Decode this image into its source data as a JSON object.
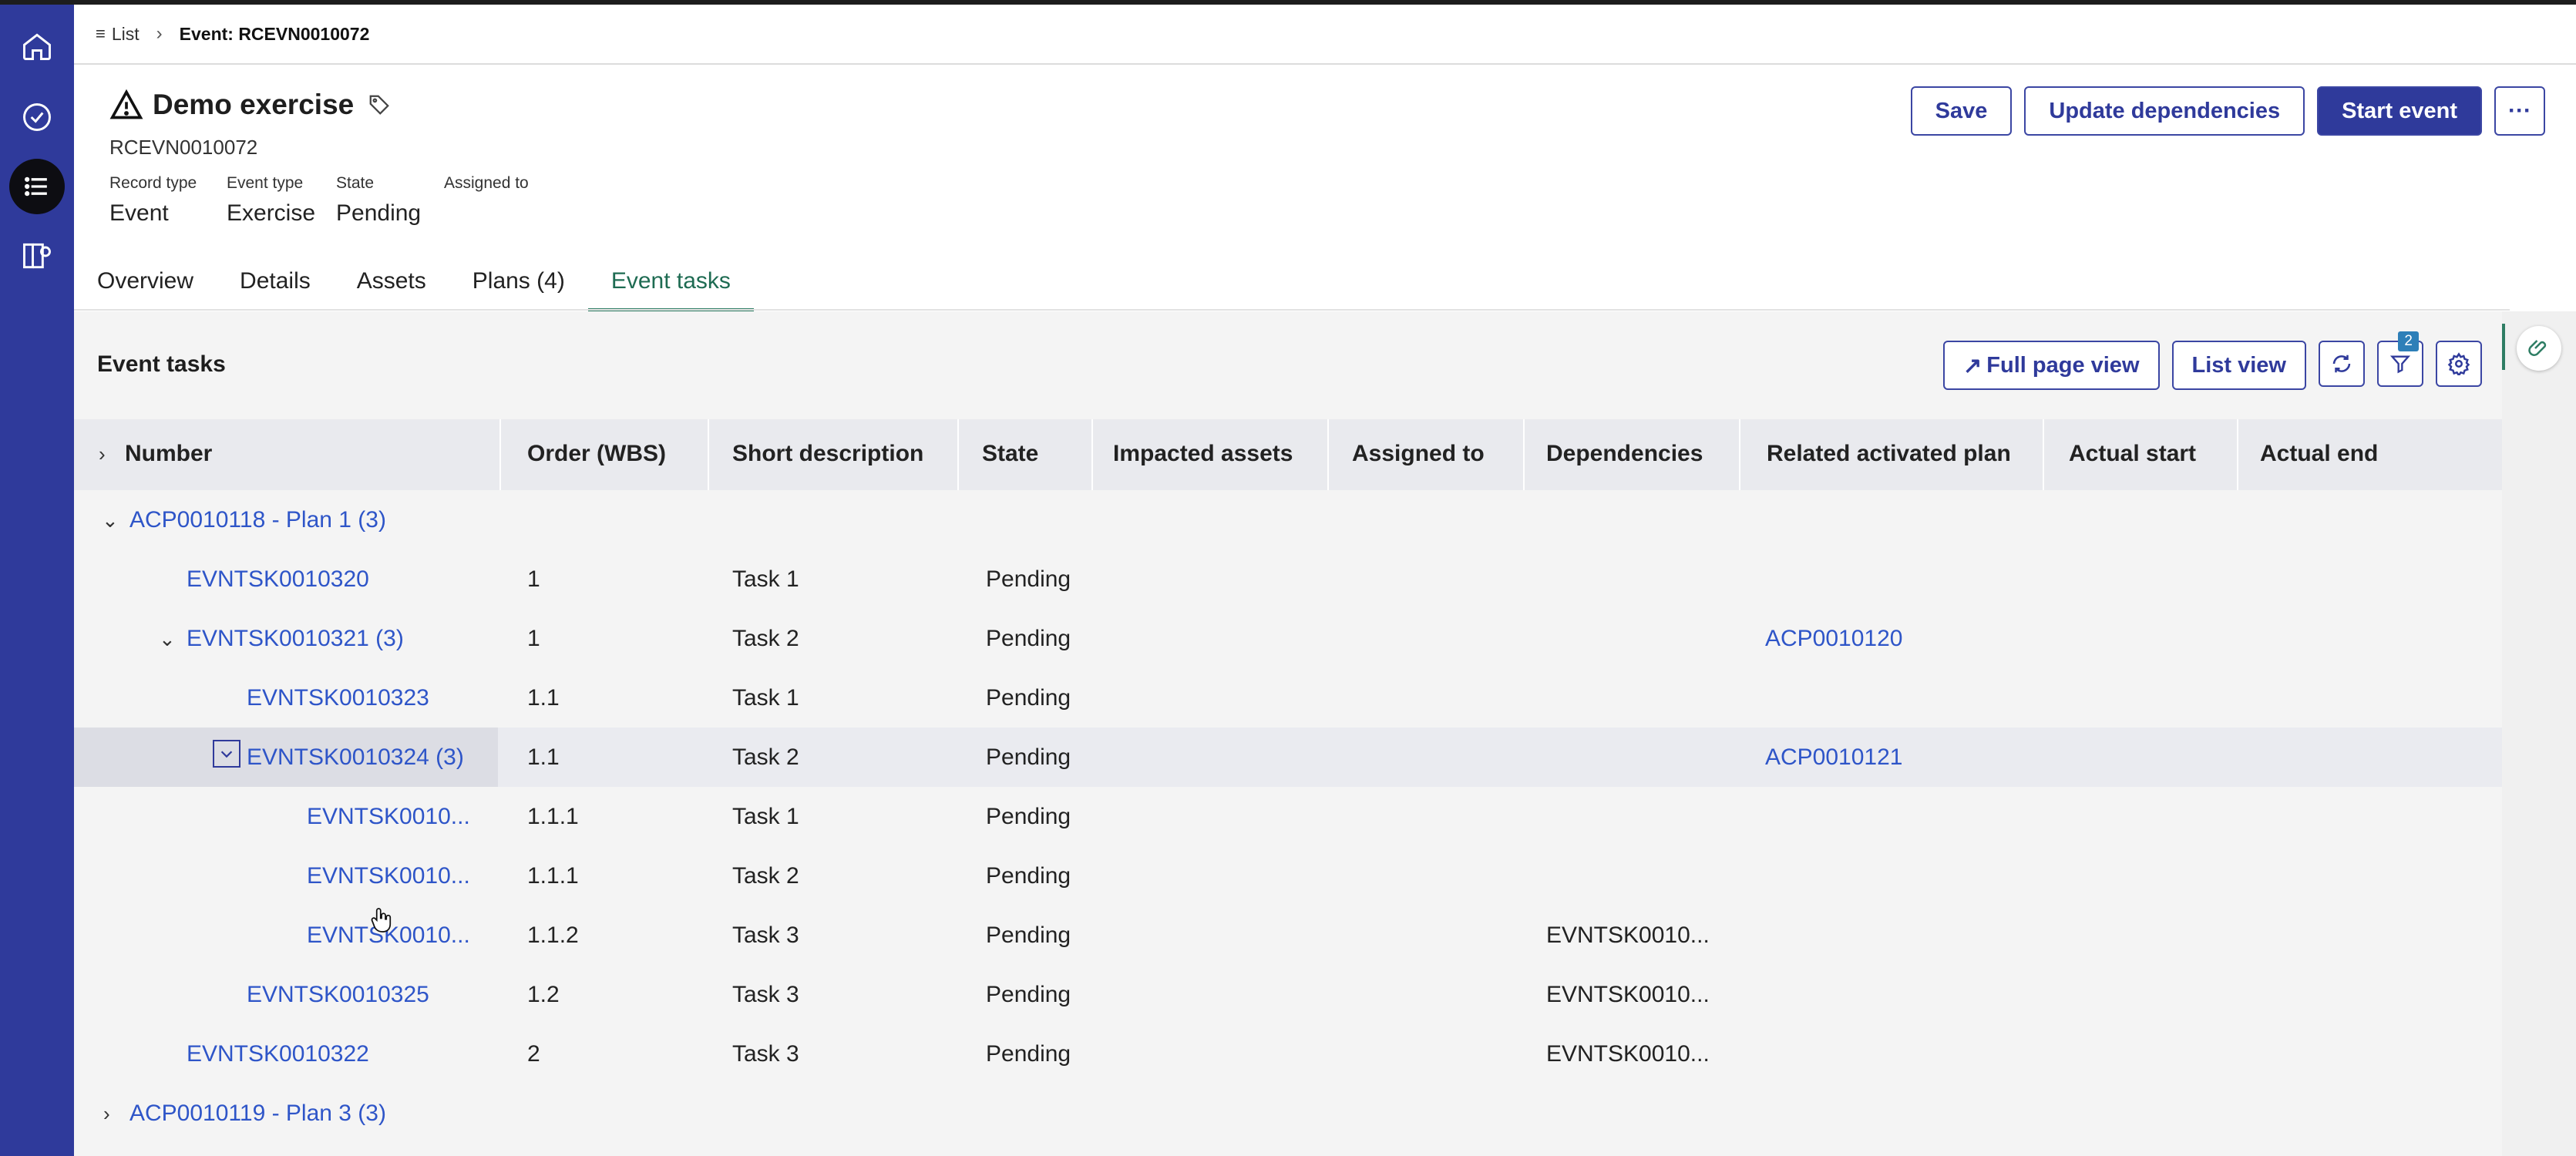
{
  "breadcrumb": {
    "list_label": "List",
    "current": "Event: RCEVN0010072"
  },
  "record": {
    "title": "Demo exercise",
    "number": "RCEVN0010072",
    "meta": [
      {
        "label": "Record type",
        "value": "Event"
      },
      {
        "label": "Event type",
        "value": "Exercise"
      },
      {
        "label": "State",
        "value": "Pending"
      },
      {
        "label": "Assigned to",
        "value": ""
      }
    ]
  },
  "actions": {
    "save": "Save",
    "update": "Update dependencies",
    "start": "Start event",
    "more": "···"
  },
  "tabs": [
    "Overview",
    "Details",
    "Assets",
    "Plans (4)",
    "Event tasks"
  ],
  "active_tab": "Event tasks",
  "panel": {
    "title": "Event tasks",
    "full_page": "Full page view",
    "list_view": "List view",
    "filter_count": "2"
  },
  "table": {
    "columns": [
      "Number",
      "Order (WBS)",
      "Short description",
      "State",
      "Impacted assets",
      "Assigned to",
      "Dependencies",
      "Related activated plan",
      "Actual start",
      "Actual end"
    ],
    "rows": [
      {
        "number": "ACP0010118 - Plan 1 (3)",
        "order": "",
        "desc": "",
        "state": "",
        "deps": "",
        "plan": ""
      },
      {
        "number": "EVNTSK0010320",
        "order": "1",
        "desc": "Task 1",
        "state": "Pending",
        "deps": "",
        "plan": ""
      },
      {
        "number": "EVNTSK0010321 (3)",
        "order": "1",
        "desc": "Task 2",
        "state": "Pending",
        "deps": "",
        "plan": "ACP0010120"
      },
      {
        "number": "EVNTSK0010323",
        "order": "1.1",
        "desc": "Task 1",
        "state": "Pending",
        "deps": "",
        "plan": ""
      },
      {
        "number": "EVNTSK0010324 (3)",
        "order": "1.1",
        "desc": "Task 2",
        "state": "Pending",
        "deps": "",
        "plan": "ACP0010121"
      },
      {
        "number": "EVNTSK0010...",
        "order": "1.1.1",
        "desc": "Task 1",
        "state": "Pending",
        "deps": "",
        "plan": ""
      },
      {
        "number": "EVNTSK0010...",
        "order": "1.1.1",
        "desc": "Task 2",
        "state": "Pending",
        "deps": "",
        "plan": ""
      },
      {
        "number": "EVNTSK0010...",
        "order": "1.1.2",
        "desc": "Task 3",
        "state": "Pending",
        "deps": "EVNTSK0010...",
        "plan": ""
      },
      {
        "number": "EVNTSK0010325",
        "order": "1.2",
        "desc": "Task 3",
        "state": "Pending",
        "deps": "EVNTSK0010...",
        "plan": ""
      },
      {
        "number": "EVNTSK0010322",
        "order": "2",
        "desc": "Task 3",
        "state": "Pending",
        "deps": "EVNTSK0010...",
        "plan": ""
      },
      {
        "number": "ACP0010119 - Plan 3 (3)",
        "order": "",
        "desc": "",
        "state": "",
        "deps": "",
        "plan": ""
      }
    ]
  },
  "colors": {
    "nav": "#2f3a9b",
    "link": "#2e55c8",
    "accent_tab": "#2e7d64"
  }
}
